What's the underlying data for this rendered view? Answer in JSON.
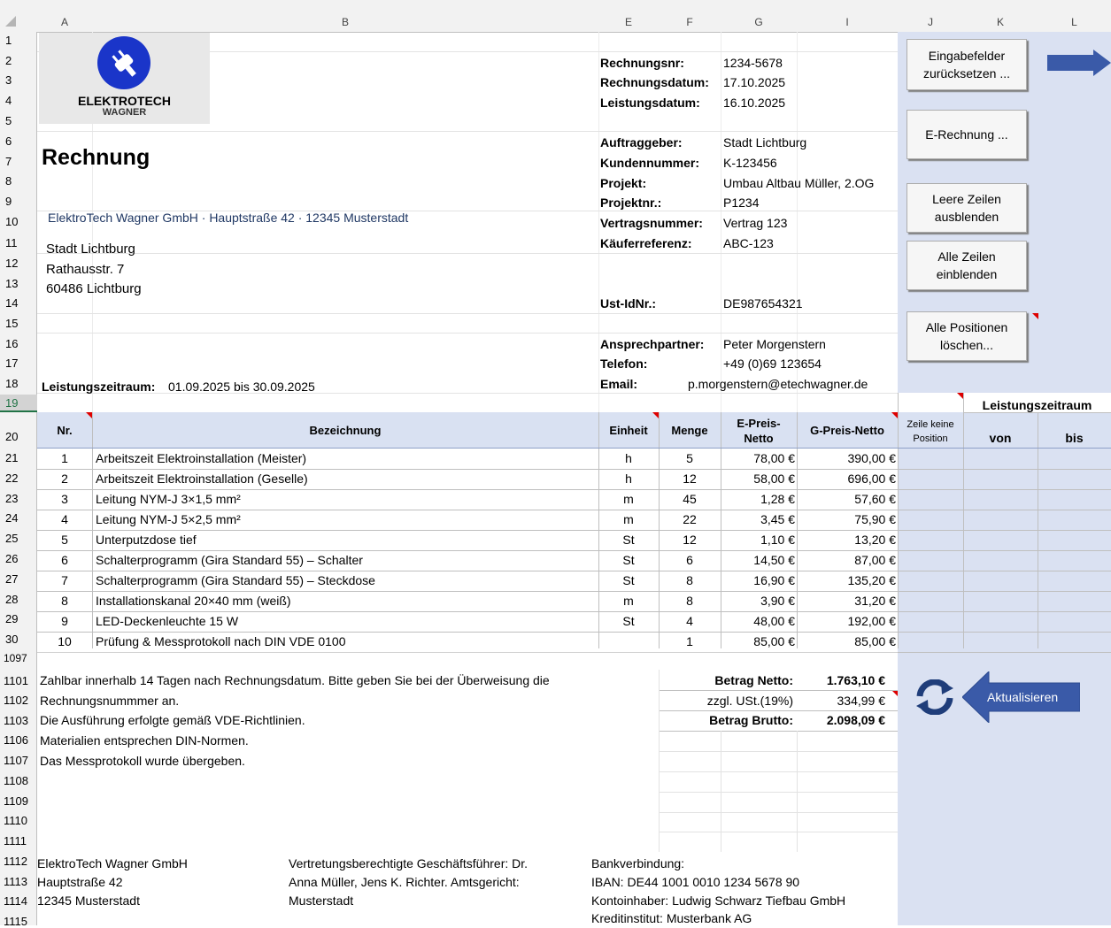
{
  "columns": [
    "A",
    "B",
    "E",
    "F",
    "G",
    "I",
    "J",
    "K",
    "L"
  ],
  "rows_top": [
    "1",
    "2",
    "3",
    "4",
    "5",
    "6",
    "7",
    "8",
    "9",
    "10",
    "11",
    "12",
    "13",
    "14",
    "15",
    "16",
    "17",
    "18",
    "19",
    "20"
  ],
  "rows_items": [
    "21",
    "22",
    "23",
    "24",
    "25",
    "26",
    "27",
    "28",
    "29",
    "30",
    "1097"
  ],
  "rows_bottom": [
    "1101",
    "1102",
    "1103",
    "1106",
    "1107",
    "1108",
    "1109",
    "1110",
    "1111",
    "1112",
    "1113",
    "1114",
    "1115"
  ],
  "logo": {
    "line1": "ELEKTROTECH",
    "line2": "WAGNER",
    "color": "#1a35c9"
  },
  "title": "Rechnung",
  "sender_line": "ElektroTech Wagner GmbH · Hauptstraße 42 · 12345 Musterstadt",
  "recipient": [
    "Stadt Lichtburg",
    "Rathausstr. 7",
    "60486 Lichtburg"
  ],
  "period": {
    "label": "Leistungszeitraum:",
    "value": "01.09.2025 bis 30.09.2025"
  },
  "meta": [
    {
      "label": "Rechnungsnr:",
      "value": "1234-5678"
    },
    {
      "label": "Rechnungsdatum:",
      "value": "17.10.2025"
    },
    {
      "label": "Leistungsdatum:",
      "value": "16.10.2025"
    },
    {
      "label": "Auftraggeber:",
      "value": "Stadt Lichtburg"
    },
    {
      "label": "Kundennummer:",
      "value": "K-123456"
    },
    {
      "label": "Projekt:",
      "value": "Umbau Altbau Müller, 2.OG"
    },
    {
      "label": "Projektnr.:",
      "value": "P1234"
    },
    {
      "label": "Vertragsnummer:",
      "value": "Vertrag 123"
    },
    {
      "label": "Käuferreferenz:",
      "value": "ABC-123"
    },
    {
      "label": "Ust-IdNr.:",
      "value": "DE987654321"
    },
    {
      "label": "Ansprechpartner:",
      "value": "Peter Morgenstern"
    },
    {
      "label": "Telefon:",
      "value": "+49 (0)69 123654"
    },
    {
      "label": "Email:",
      "value": "p.morgenstern@etechwagner.de"
    }
  ],
  "buttons": {
    "reset": "Eingabefelder zurücksetzen ...",
    "erechnung": "E-Rechnung ...",
    "hide_empty": "Leere Zeilen ausblenden",
    "show_all": "Alle Zeilen einblenden",
    "delete_all": "Alle Positionen löschen...",
    "refresh": "Aktualisieren"
  },
  "table": {
    "headers": {
      "nr": "Nr.",
      "bez": "Bezeichnung",
      "einheit": "Einheit",
      "menge": "Menge",
      "epreis": "E-Preis-Netto",
      "gpreis": "G-Preis-Netto",
      "keine_position": "Zeile keine Position",
      "leistungszeitraum": "Leistungszeitraum",
      "von": "von",
      "bis": "bis"
    },
    "items": [
      {
        "nr": "1",
        "bez": "Arbeitszeit Elektroinstallation (Meister)",
        "einheit": "h",
        "menge": "5",
        "epreis": "78,00 €",
        "gpreis": "390,00 €"
      },
      {
        "nr": "2",
        "bez": "Arbeitszeit Elektroinstallation (Geselle)",
        "einheit": "h",
        "menge": "12",
        "epreis": "58,00 €",
        "gpreis": "696,00 €"
      },
      {
        "nr": "3",
        "bez": "Leitung NYM-J 3×1,5 mm²",
        "einheit": "m",
        "menge": "45",
        "epreis": "1,28 €",
        "gpreis": "57,60 €"
      },
      {
        "nr": "4",
        "bez": "Leitung NYM-J 5×2,5 mm²",
        "einheit": "m",
        "menge": "22",
        "epreis": "3,45 €",
        "gpreis": "75,90 €"
      },
      {
        "nr": "5",
        "bez": "Unterputzdose tief",
        "einheit": "St",
        "menge": "12",
        "epreis": "1,10 €",
        "gpreis": "13,20 €"
      },
      {
        "nr": "6",
        "bez": "Schalterprogramm (Gira Standard 55) – Schalter",
        "einheit": "St",
        "menge": "6",
        "epreis": "14,50 €",
        "gpreis": "87,00 €"
      },
      {
        "nr": "7",
        "bez": "Schalterprogramm (Gira Standard 55) – Steckdose",
        "einheit": "St",
        "menge": "8",
        "epreis": "16,90 €",
        "gpreis": "135,20 €"
      },
      {
        "nr": "8",
        "bez": "Installationskanal 20×40 mm (weiß)",
        "einheit": "m",
        "menge": "8",
        "epreis": "3,90 €",
        "gpreis": "31,20 €"
      },
      {
        "nr": "9",
        "bez": "LED-Deckenleuchte 15 W",
        "einheit": "St",
        "menge": "4",
        "epreis": "48,00 €",
        "gpreis": "192,00 €"
      },
      {
        "nr": "10",
        "bez": "Prüfung & Messprotokoll nach DIN VDE 0100",
        "einheit": "",
        "menge": "1",
        "epreis": "85,00 €",
        "gpreis": "85,00 €"
      }
    ]
  },
  "notes": [
    "Zahlbar innerhalb 14 Tagen nach Rechnungsdatum. Bitte geben Sie bei der Überweisung die",
    "Rechnungsnummmer an.",
    "Die Ausführung erfolgte gemäß VDE-Richtlinien.",
    "Materialien entsprechen DIN-Normen.",
    "Das Messprotokoll wurde übergeben."
  ],
  "totals": {
    "netto_label": "Betrag Netto:",
    "netto": "1.763,10 €",
    "ust_label": "zzgl. USt.(19%)",
    "ust": "334,99 €",
    "brutto_label": "Betrag Brutto:",
    "brutto": "2.098,09 €"
  },
  "footer": {
    "company": [
      "ElektroTech Wagner GmbH",
      "Hauptstraße 42",
      "12345 Musterstadt"
    ],
    "legal": [
      "Vertretungsberechtigte Geschäftsführer: Dr.",
      "Anna Müller, Jens K. Richter. Amtsgericht:",
      "Musterstadt"
    ],
    "bank": [
      "Bankverbindung:",
      "IBAN: DE44 1001 0010 1234 5678 90",
      "Kontoinhaber: Ludwig Schwarz Tiefbau GmbH",
      "Kreditinstitut: Musterbank AG"
    ]
  },
  "colors": {
    "accent": "#3a5aa8",
    "header_fill": "#d9e1f2",
    "panel": "#dae1f2",
    "comment_marker": "#dd0000"
  }
}
